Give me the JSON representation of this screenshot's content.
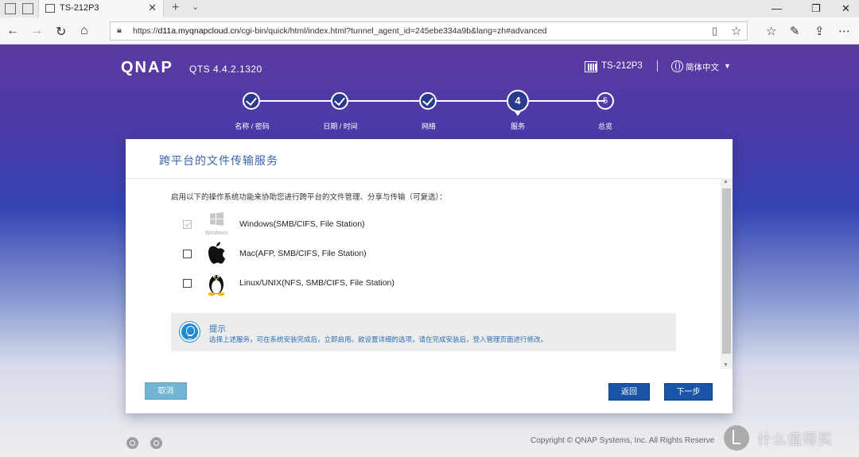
{
  "browser": {
    "tab_title": "TS-212P3",
    "url_prefix": "https://",
    "url_host": "d11a.myqnapcloud.cn",
    "url_path": "/cgi-bin/quick/html/index.html?tunnel_agent_id=245ebe334a9b&lang=zh#advanced"
  },
  "header": {
    "brand": "QNAP",
    "version": "QTS 4.4.2.1320",
    "device_name": "TS-212P3",
    "language": "简体中文"
  },
  "steps": [
    {
      "label": "名称 / 密码",
      "state": "done"
    },
    {
      "label": "日期 / 时间",
      "state": "done"
    },
    {
      "label": "网络",
      "state": "done"
    },
    {
      "label": "服务",
      "state": "current",
      "number": "4"
    },
    {
      "label": "总览",
      "state": "todo",
      "number": "5"
    }
  ],
  "panel": {
    "title": "跨平台的文件传输服务",
    "intro": "启用以下的操作系统功能来协助您进行跨平台的文件管理、分享与传输（可复选）：",
    "options": [
      {
        "label": "Windows(SMB/CIFS, File Station)",
        "checked": true,
        "disabled": true,
        "icon": "windows-icon",
        "icon_caption": "Windows"
      },
      {
        "label": "Mac(AFP, SMB/CIFS, File Station)",
        "checked": false,
        "disabled": false,
        "icon": "apple-icon"
      },
      {
        "label": "Linux/UNIX(NFS, SMB/CIFS, File Station)",
        "checked": false,
        "disabled": false,
        "icon": "tux-penguin-icon"
      }
    ],
    "tip": {
      "title": "提示",
      "text": "选择上述服务，可在系统安装完成后，立即启用。欲设置详细的选项，请在完成安装后，登入管理页面进行修改。"
    },
    "buttons": {
      "cancel": "取消",
      "back": "返回",
      "next": "下一步"
    }
  },
  "footer": {
    "copyright": "Copyright © QNAP Systems, Inc. All Rights Reserve",
    "watermark": "什么值得买"
  },
  "colors": {
    "accent": "#1a54a8",
    "title_blue": "#3a63b0",
    "cancel_button": "#72b4d2",
    "tip_blue": "#1e8ad0"
  }
}
